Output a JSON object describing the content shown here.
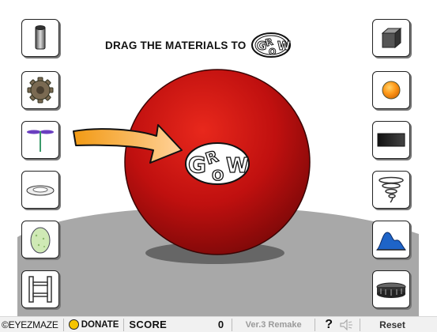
{
  "header": {
    "instruction": "DRAG THE MATERIALS TO",
    "logo_text": "GROW"
  },
  "materials": {
    "left": [
      "pipe-icon",
      "gear-icon",
      "propeller-icon",
      "plate-icon",
      "egg-icon",
      "ladder-icon"
    ],
    "right": [
      "cube-icon",
      "orange-ball-icon",
      "black-panel-icon",
      "tornado-icon",
      "blue-mountain-icon",
      "tire-icon"
    ]
  },
  "sphere": {
    "color": "#c0100f",
    "highlight": "#e8281c",
    "logo_text": "GROW"
  },
  "status_bar": {
    "credit": "©EYEZMAZE",
    "donate_label": "DONATE",
    "score_label": "SCORE",
    "score_value": "0",
    "version": "Ver.3 Remake",
    "help_label": "?",
    "reset_label": "Reset"
  },
  "colors": {
    "ground": "#a8a8a8",
    "arrow": "#f5a623"
  }
}
